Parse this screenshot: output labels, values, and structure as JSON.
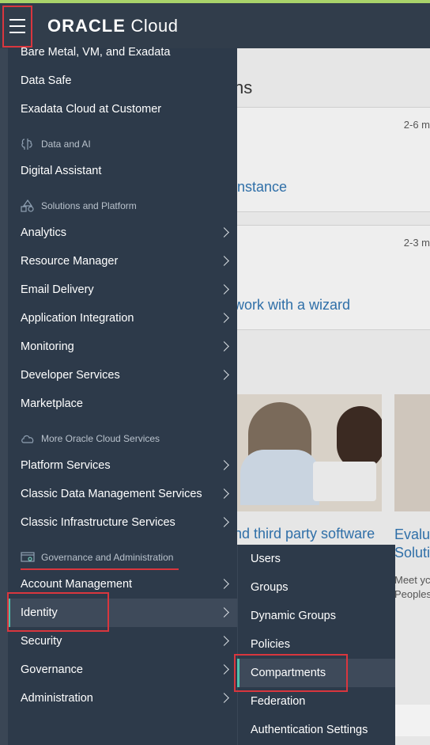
{
  "header": {
    "brand_bold": "ORACLE",
    "brand_light": " Cloud"
  },
  "background": {
    "title_partial": "ns",
    "cards": [
      {
        "time": "2-6 m",
        "link": "instance"
      },
      {
        "time": "2-3 m",
        "link": "work with a wizard"
      }
    ],
    "image_caption": "nd third party software",
    "right_title_line1": "Evalua",
    "right_title_line2": "Solutic",
    "right_text_line1": "Meet yc",
    "right_text_line2": "Peoples"
  },
  "nav": {
    "items": [
      {
        "label": "Bare Metal, VM, and Exadata",
        "chevron": false
      },
      {
        "label": "Data Safe",
        "chevron": false
      },
      {
        "label": "Exadata Cloud at Customer",
        "chevron": false
      },
      {
        "label": "Digital Assistant",
        "chevron": false
      },
      {
        "label": "Analytics",
        "chevron": true
      },
      {
        "label": "Resource Manager",
        "chevron": true
      },
      {
        "label": "Email Delivery",
        "chevron": true
      },
      {
        "label": "Application Integration",
        "chevron": true
      },
      {
        "label": "Monitoring",
        "chevron": true
      },
      {
        "label": "Developer Services",
        "chevron": true
      },
      {
        "label": "Marketplace",
        "chevron": false
      },
      {
        "label": "Platform Services",
        "chevron": true
      },
      {
        "label": "Classic Data Management Services",
        "chevron": true
      },
      {
        "label": "Classic Infrastructure Services",
        "chevron": true
      },
      {
        "label": "Account Management",
        "chevron": true
      },
      {
        "label": "Identity",
        "chevron": true,
        "active": true
      },
      {
        "label": "Security",
        "chevron": true
      },
      {
        "label": "Governance",
        "chevron": true
      },
      {
        "label": "Administration",
        "chevron": true
      }
    ],
    "sections": [
      {
        "label": "Data and AI",
        "icon": "brain-icon"
      },
      {
        "label": "Solutions and Platform",
        "icon": "shapes-icon"
      },
      {
        "label": "More Oracle Cloud Services",
        "icon": "cloud-icon"
      },
      {
        "label": "Governance and Administration",
        "icon": "governance-icon"
      }
    ]
  },
  "submenu": {
    "items": [
      {
        "label": "Users"
      },
      {
        "label": "Groups"
      },
      {
        "label": "Dynamic Groups"
      },
      {
        "label": "Policies"
      },
      {
        "label": "Compartments",
        "active": true
      },
      {
        "label": "Federation"
      },
      {
        "label": "Authentication Settings"
      }
    ]
  },
  "colors": {
    "header_bg": "#313d4b",
    "menu_bg": "#2d3a4a",
    "active_accent": "#4fc1ad",
    "highlight": "#d9363e",
    "link": "#2f6fa8"
  }
}
